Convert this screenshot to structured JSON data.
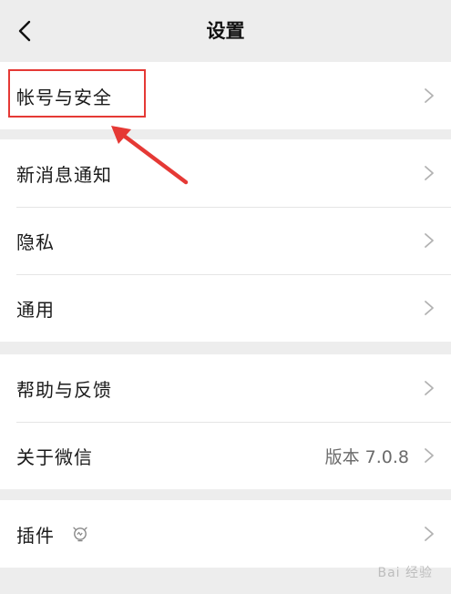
{
  "nav": {
    "title": "设置"
  },
  "groups": [
    {
      "items": [
        {
          "label": "帐号与安全"
        }
      ]
    },
    {
      "items": [
        {
          "label": "新消息通知"
        },
        {
          "label": "隐私"
        },
        {
          "label": "通用"
        }
      ]
    },
    {
      "items": [
        {
          "label": "帮助与反馈"
        },
        {
          "label": "关于微信",
          "value": "版本 7.0.8"
        }
      ]
    },
    {
      "items": [
        {
          "label": "插件"
        }
      ]
    }
  ],
  "watermark": "Bai 经验",
  "colors": {
    "background": "#ededed",
    "card": "#ffffff",
    "highlight": "#e53935"
  },
  "icons": {
    "back": "chevron-left-icon",
    "row_arrow": "chevron-right-icon",
    "plugin": "plugin-bulb-icon"
  }
}
